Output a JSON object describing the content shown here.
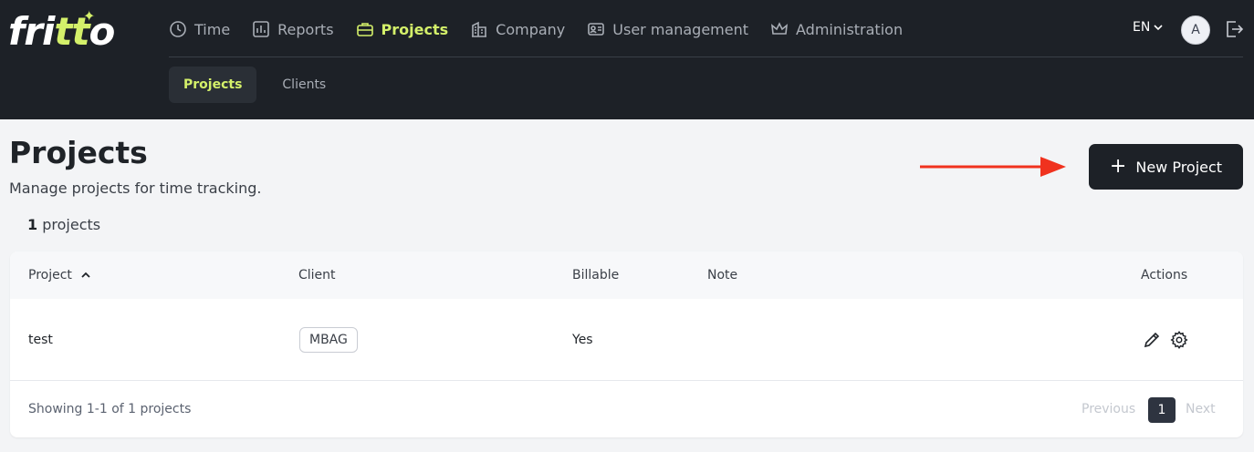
{
  "app": {
    "logo_main": "fri",
    "logo_accent": "tt",
    "logo_end": "o",
    "accent_color": "#d4f06a"
  },
  "nav": {
    "items": [
      {
        "label": "Time",
        "icon": "clock-icon"
      },
      {
        "label": "Reports",
        "icon": "bar-chart-icon"
      },
      {
        "label": "Projects",
        "icon": "briefcase-icon",
        "active": true
      },
      {
        "label": "Company",
        "icon": "building-icon"
      },
      {
        "label": "User management",
        "icon": "id-card-icon"
      },
      {
        "label": "Administration",
        "icon": "crown-icon"
      }
    ]
  },
  "subnav": {
    "items": [
      {
        "label": "Projects",
        "active": true
      },
      {
        "label": "Clients"
      }
    ]
  },
  "header_right": {
    "language": "EN",
    "avatar_initial": "A"
  },
  "page": {
    "title": "Projects",
    "subtitle": "Manage projects for time tracking.",
    "count_number": "1",
    "count_label": " projects",
    "new_button_label": "New Project"
  },
  "table": {
    "columns": [
      "Project",
      "Client",
      "Billable",
      "Note",
      "Actions"
    ],
    "rows": [
      {
        "project": "test",
        "client": "MBAG",
        "billable": "Yes",
        "note": ""
      }
    ],
    "footer": "Showing 1-1 of 1 projects",
    "pagination": {
      "prev": "Previous",
      "current": "1",
      "next": "Next"
    }
  }
}
